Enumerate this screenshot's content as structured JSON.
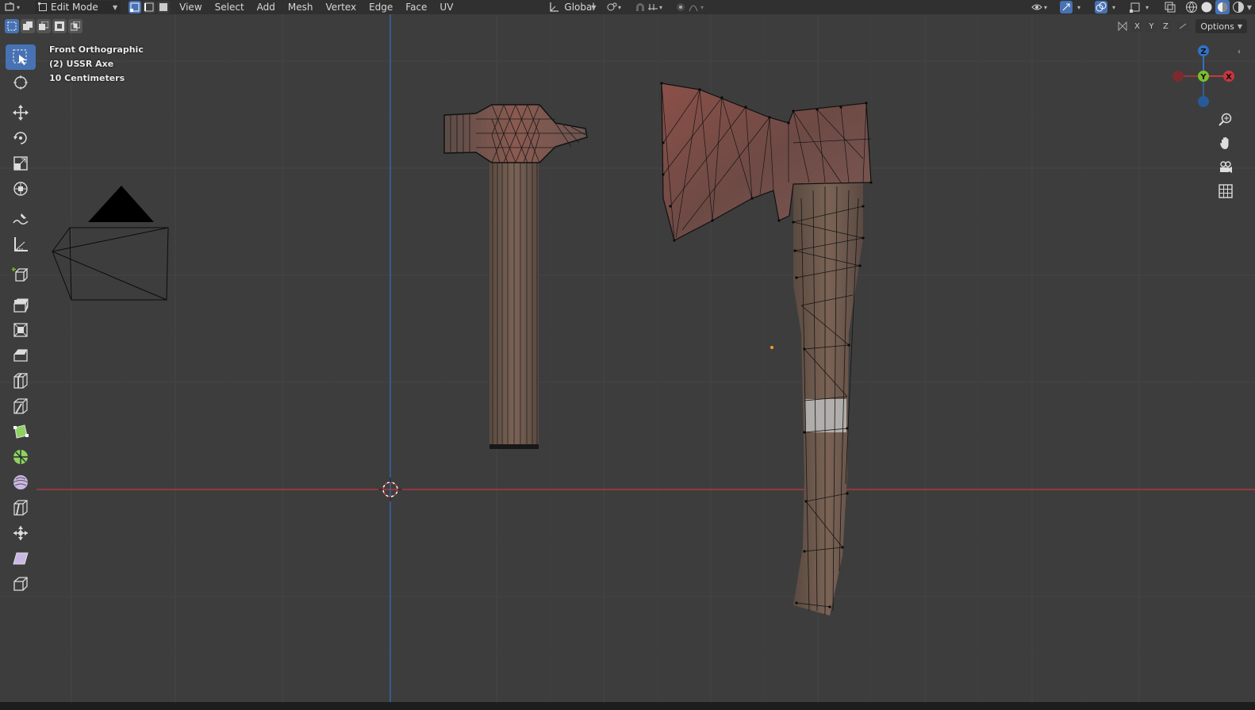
{
  "header": {
    "mode": "Edit Mode",
    "menus": [
      "View",
      "Select",
      "Add",
      "Mesh",
      "Vertex",
      "Edge",
      "Face",
      "UV"
    ],
    "orientation": "Global"
  },
  "viewport": {
    "view_name": "Front Orthographic",
    "object_name": "(2) USSR Axe",
    "grid_scale": "10 Centimeters",
    "options_label": "Options",
    "axis_buttons": [
      "X",
      "Y",
      "Z"
    ]
  },
  "gizmo": {
    "z": "Z",
    "y": "Y",
    "x": "X"
  },
  "tools": [
    {
      "name": "select-box-icon"
    },
    {
      "name": "cursor-icon"
    },
    {
      "name": "move-icon"
    },
    {
      "name": "rotate-icon"
    },
    {
      "name": "scale-icon"
    },
    {
      "name": "transform-icon"
    },
    {
      "name": "annotate-icon"
    },
    {
      "name": "measure-icon"
    },
    {
      "name": "add-cube-icon"
    },
    {
      "name": "extrude-region-icon"
    },
    {
      "name": "inset-faces-icon"
    },
    {
      "name": "bevel-icon"
    },
    {
      "name": "loop-cut-icon"
    },
    {
      "name": "knife-icon"
    },
    {
      "name": "poly-build-icon"
    },
    {
      "name": "spin-icon"
    },
    {
      "name": "smooth-icon"
    },
    {
      "name": "edge-slide-icon"
    },
    {
      "name": "shrink-fatten-icon"
    },
    {
      "name": "shear-icon"
    },
    {
      "name": "rip-region-icon"
    }
  ],
  "colors": {
    "viewport_bg": "#3d3d3d",
    "header_bg": "#303030",
    "accent": "#4772b3",
    "axis_x": "#c9353d",
    "axis_y": "#7cbd2b",
    "axis_z": "#2f72c7"
  }
}
